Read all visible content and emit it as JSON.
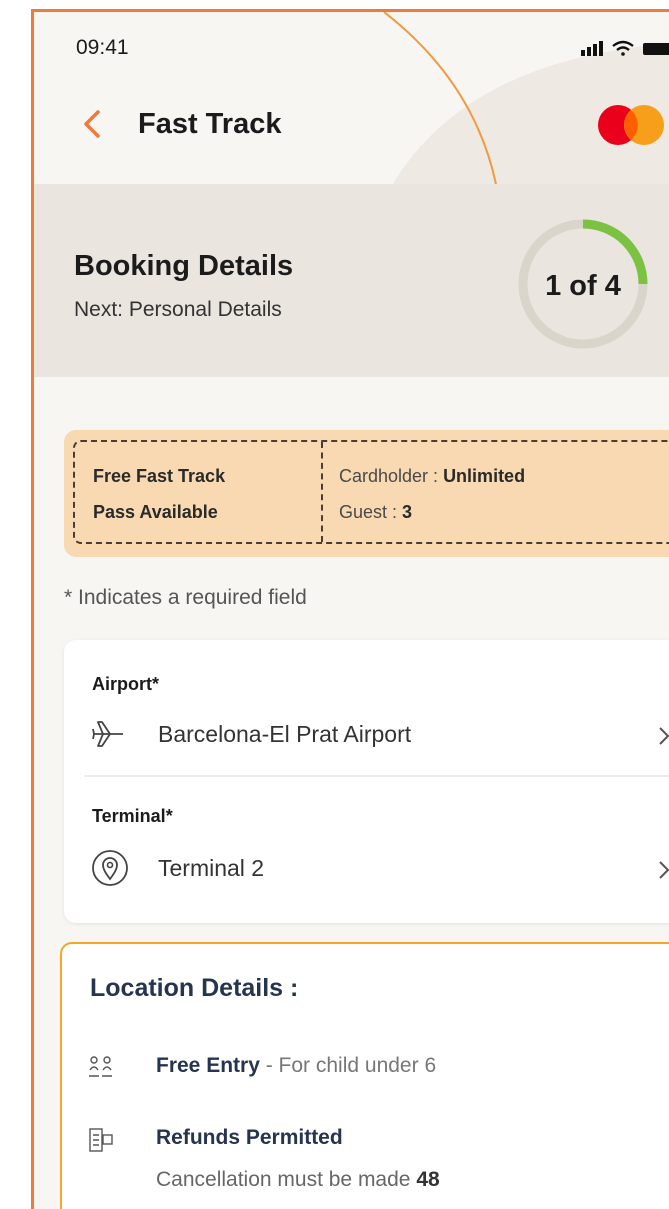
{
  "status_bar": {
    "time": "09:41"
  },
  "header": {
    "title": "Fast Track"
  },
  "booking": {
    "title": "Booking Details",
    "next": "Next: Personal Details",
    "step_label": "1 of 4",
    "step_current": 1,
    "step_total": 4
  },
  "pass": {
    "line1": "Free Fast Track",
    "line2": "Pass Available",
    "cardholder_label": "Cardholder : ",
    "cardholder_value": "Unlimited",
    "guest_label": "Guest : ",
    "guest_value": "3"
  },
  "required_note": "* Indicates a required field",
  "fields": {
    "airport_label": "Airport*",
    "airport_value": "Barcelona-El Prat Airport",
    "terminal_label": "Terminal*",
    "terminal_value": "Terminal 2"
  },
  "location": {
    "title": "Location Details :",
    "free_entry": "Free Entry",
    "free_entry_note": " - For child under 6",
    "refunds": "Refunds Permitted",
    "cancellation_text": "Cancellation must be made ",
    "cancellation_value": "48"
  },
  "colors": {
    "accent_orange": "#f07a3a",
    "progress_green": "#7cc242",
    "pass_bg": "#f9d9b2",
    "mastercard_red": "#eb001b",
    "mastercard_orange": "#f79e1b"
  },
  "icons": [
    "back-arrow-icon",
    "mastercard-logo",
    "signal-icon",
    "wifi-icon",
    "battery-icon",
    "plane-icon",
    "location-pin-icon",
    "chevron-right-icon",
    "family-icon",
    "refund-icon"
  ]
}
